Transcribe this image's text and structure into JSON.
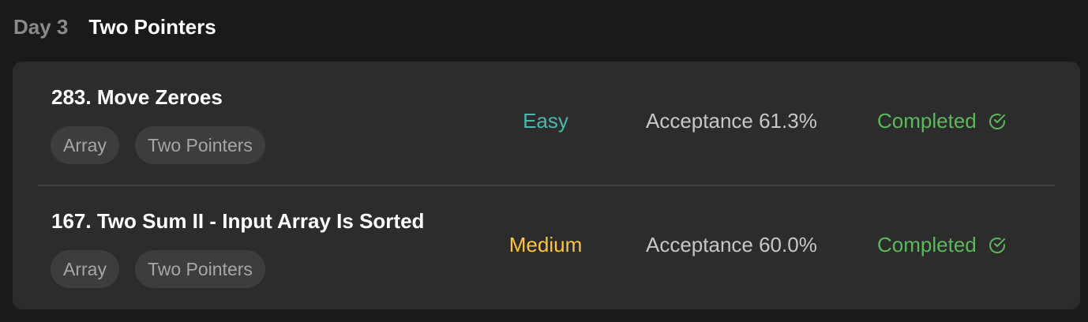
{
  "header": {
    "day": "Day 3",
    "title": "Two Pointers"
  },
  "problems": [
    {
      "title": "283. Move Zeroes",
      "tags": [
        "Array",
        "Two Pointers"
      ],
      "difficulty": "Easy",
      "difficulty_color": "#4db6ac",
      "acceptance": "Acceptance 61.3%",
      "status": "Completed",
      "status_icon": "check-circle-icon"
    },
    {
      "title": "167. Two Sum II - Input Array Is Sorted",
      "tags": [
        "Array",
        "Two Pointers"
      ],
      "difficulty": "Medium",
      "difficulty_color": "#ffc43d",
      "acceptance": "Acceptance 60.0%",
      "status": "Completed",
      "status_icon": "check-circle-icon"
    }
  ],
  "colors": {
    "background": "#1a1a1a",
    "card": "#2c2c2c",
    "completed": "#5cb85c"
  }
}
